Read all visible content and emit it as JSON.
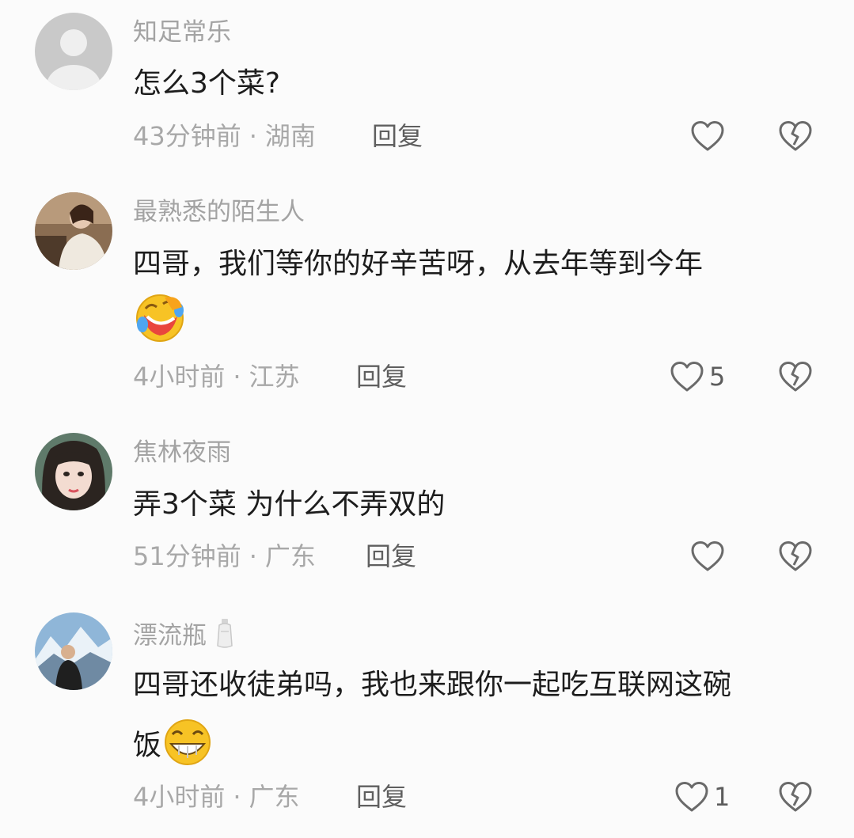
{
  "comments": [
    {
      "username": "知足常乐",
      "text": "怎么3个菜?",
      "time": "43分钟前",
      "location": "湖南",
      "reply_label": "回复",
      "like_count": ""
    },
    {
      "username": "最熟悉的陌生人",
      "text": "四哥，我们等你的好辛苦呀，从去年等到今年",
      "time": "4小时前",
      "location": "江苏",
      "reply_label": "回复",
      "like_count": "5"
    },
    {
      "username": "焦林夜雨",
      "text": "弄3个菜 为什么不弄双的",
      "time": "51分钟前",
      "location": "广东",
      "reply_label": "回复",
      "like_count": ""
    },
    {
      "username": "漂流瓶",
      "text_line1": "四哥还收徒弟吗，我也来跟你一起吃互联网这碗",
      "text_line2": "饭",
      "time": "4小时前",
      "location": "广东",
      "reply_label": "回复",
      "like_count": "1"
    }
  ],
  "separator": "·",
  "icons": {
    "like": "heart-outline-icon",
    "dislike": "broken-heart-icon",
    "emoji_crying_laughing": "rolling-laughing-emoji",
    "emoji_grin": "grinning-emoji",
    "name_badge": "bottle-icon"
  },
  "colors": {
    "background": "#fbfbfb",
    "username": "#a3a3a3",
    "text": "#1d1d1d",
    "meta": "#a8a8a8",
    "icon": "#6a6a6a"
  }
}
